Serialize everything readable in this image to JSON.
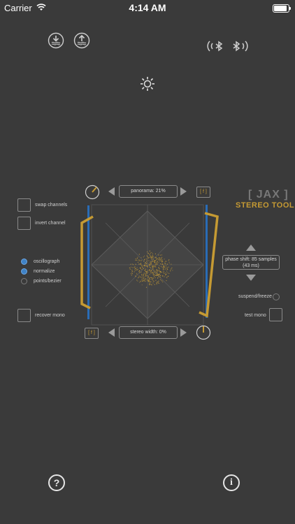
{
  "status": {
    "carrier": "Carrier",
    "time": "4:14 AM",
    "battery_level": 0.9
  },
  "top_icons": [
    "download-icon",
    "upload-icon",
    "bluetooth-left-icon",
    "bluetooth-right-icon",
    "brightness-icon"
  ],
  "left_controls": {
    "swap_channels": "swap channels",
    "invert_channel": "invert channel",
    "modes": [
      {
        "label": "oscillograph",
        "selected": true
      },
      {
        "label": "normalize",
        "selected": true
      },
      {
        "label": "points/bezier",
        "selected": false
      }
    ],
    "recover_mono": "recover mono"
  },
  "scope": {
    "panorama": "panorama: 21%",
    "stereo_width": "stereo width: 0%",
    "f_label_top": "[ f ]",
    "f_label_bottom": "[ f ]",
    "accent": "#c59a33",
    "channel_color": "#2a6cb6"
  },
  "brand": {
    "line1": "[ JAX ]",
    "line2": "STEREO TOOL"
  },
  "right_controls": {
    "phase_shift_line1": "phase shift: 85 samples",
    "phase_shift_line2": "(43 ms)",
    "suspend_freeze": "suspend/freeze",
    "test_mono": "test mono"
  },
  "bottom": {
    "help_symbol": "?",
    "info_symbol": "i"
  }
}
